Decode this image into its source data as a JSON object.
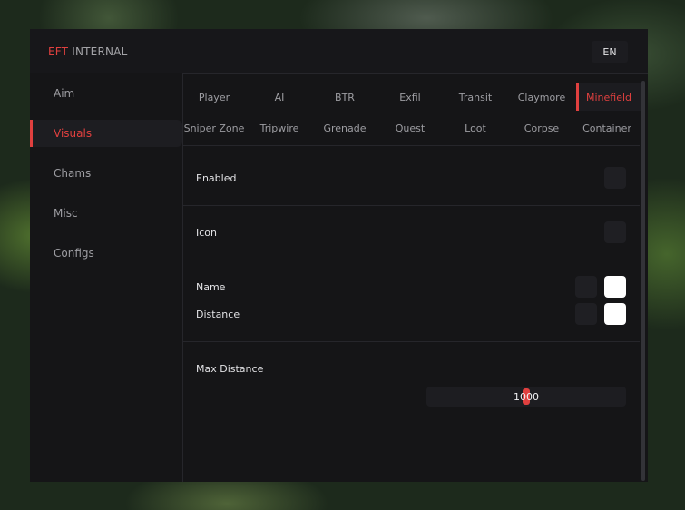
{
  "header": {
    "brand": "EFT",
    "title_rest": "INTERNAL",
    "language": "EN"
  },
  "sidebar": {
    "items": [
      {
        "label": "Aim"
      },
      {
        "label": "Visuals"
      },
      {
        "label": "Chams"
      },
      {
        "label": "Misc"
      },
      {
        "label": "Configs"
      }
    ],
    "active": "Visuals"
  },
  "tabs": {
    "row1": [
      "Player",
      "AI",
      "BTR",
      "Exfil",
      "Transit",
      "Claymore",
      "Minefield"
    ],
    "row2": [
      "Sniper Zone",
      "Tripwire",
      "Grenade",
      "Quest",
      "Loot",
      "Corpse",
      "Container"
    ],
    "active": "Minefield"
  },
  "settings": {
    "enabled": {
      "label": "Enabled",
      "checked": false
    },
    "icon": {
      "label": "Icon",
      "checked": false
    },
    "name": {
      "label": "Name",
      "checked": false,
      "color": "#ffffff"
    },
    "distance": {
      "label": "Distance",
      "checked": false,
      "color": "#ffffff"
    },
    "max_distance": {
      "label": "Max Distance",
      "value": "1000",
      "fraction": 0.5
    }
  },
  "colors": {
    "accent": "#e0403f",
    "panel": "#151517",
    "text": "#e2e2e5",
    "muted": "#9d9da2"
  }
}
